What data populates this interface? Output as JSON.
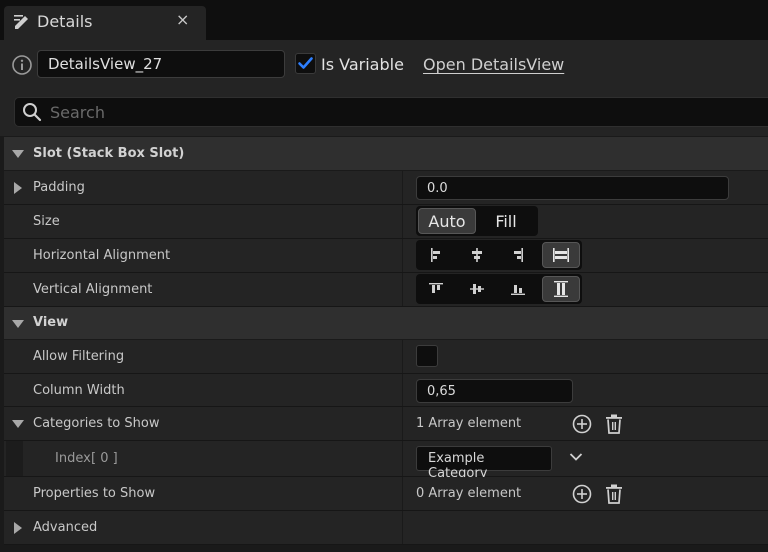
{
  "tab": {
    "title": "Details",
    "close": "×",
    "icon": "pencil-icon"
  },
  "header": {
    "name_value": "DetailsView_27",
    "is_variable_label": "Is Variable",
    "is_variable_checked": true,
    "open_link": "Open DetailsView",
    "search_placeholder": "Search"
  },
  "sections": {
    "slot": {
      "title": "Slot (Stack Box Slot)",
      "padding": {
        "label": "Padding",
        "value": "0.0"
      },
      "size": {
        "label": "Size",
        "options": [
          "Auto",
          "Fill"
        ],
        "selected": "Auto"
      },
      "h_align": {
        "label": "Horizontal Alignment",
        "options": [
          "align-left-icon",
          "align-center-icon",
          "align-right-icon",
          "align-fill-icon"
        ],
        "selected": "align-fill-icon"
      },
      "v_align": {
        "label": "Vertical Alignment",
        "options": [
          "align-top-icon",
          "align-middle-icon",
          "align-bottom-icon",
          "align-vfill-icon"
        ],
        "selected": "align-vfill-icon"
      }
    },
    "view": {
      "title": "View",
      "allow_filtering": {
        "label": "Allow Filtering",
        "checked": false
      },
      "column_width": {
        "label": "Column Width",
        "value": "0,65"
      },
      "categories": {
        "label": "Categories to Show",
        "summary": "1 Array element",
        "items": [
          {
            "index_label": "Index",
            "index_number": "[ 0 ]",
            "value": "Example Category"
          }
        ]
      },
      "properties": {
        "label": "Properties to Show",
        "summary": "0 Array element"
      }
    },
    "advanced": {
      "title": "Advanced"
    }
  },
  "colors": {
    "accent": "#2d7fff",
    "background": "#1a1a1a",
    "panel": "#242424",
    "category": "#2f2f2f"
  }
}
